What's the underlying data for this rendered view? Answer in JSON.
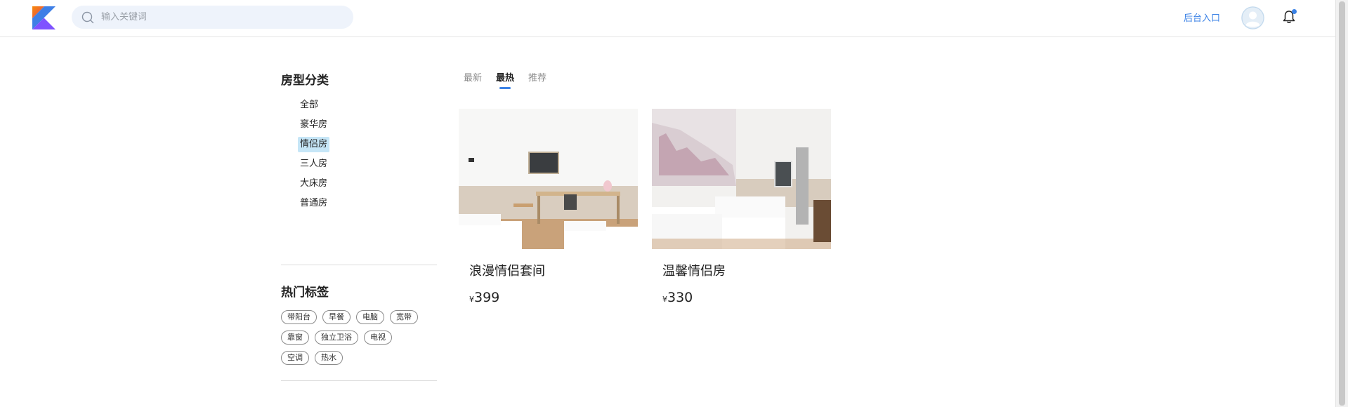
{
  "header": {
    "search_placeholder": "输入关键词",
    "admin_link": "后台入口",
    "icons": {
      "logo": "kotlin-logo",
      "search": "search-icon",
      "avatar": "avatar",
      "notifications": "bell-icon"
    },
    "accent_color": "#3b82e6"
  },
  "sidebar": {
    "category_title": "房型分类",
    "categories": [
      {
        "label": "全部"
      },
      {
        "label": "豪华房"
      },
      {
        "label": "情侣房",
        "active": true
      },
      {
        "label": "三人房"
      },
      {
        "label": "大床房"
      },
      {
        "label": "普通房"
      }
    ],
    "tags_title": "热门标签",
    "tags": [
      [
        "带阳台",
        "早餐",
        "电脑",
        "宽带"
      ],
      [
        "靠窗",
        "独立卫浴",
        "电视"
      ],
      [
        "空调",
        "热水"
      ]
    ]
  },
  "tabs": [
    {
      "label": "最新"
    },
    {
      "label": "最热",
      "active": true
    },
    {
      "label": "推荐"
    }
  ],
  "rooms": [
    {
      "name": "浪漫情侣套间",
      "currency": "¥",
      "price": "399"
    },
    {
      "name": "温馨情侣房",
      "currency": "¥",
      "price": "330"
    }
  ]
}
